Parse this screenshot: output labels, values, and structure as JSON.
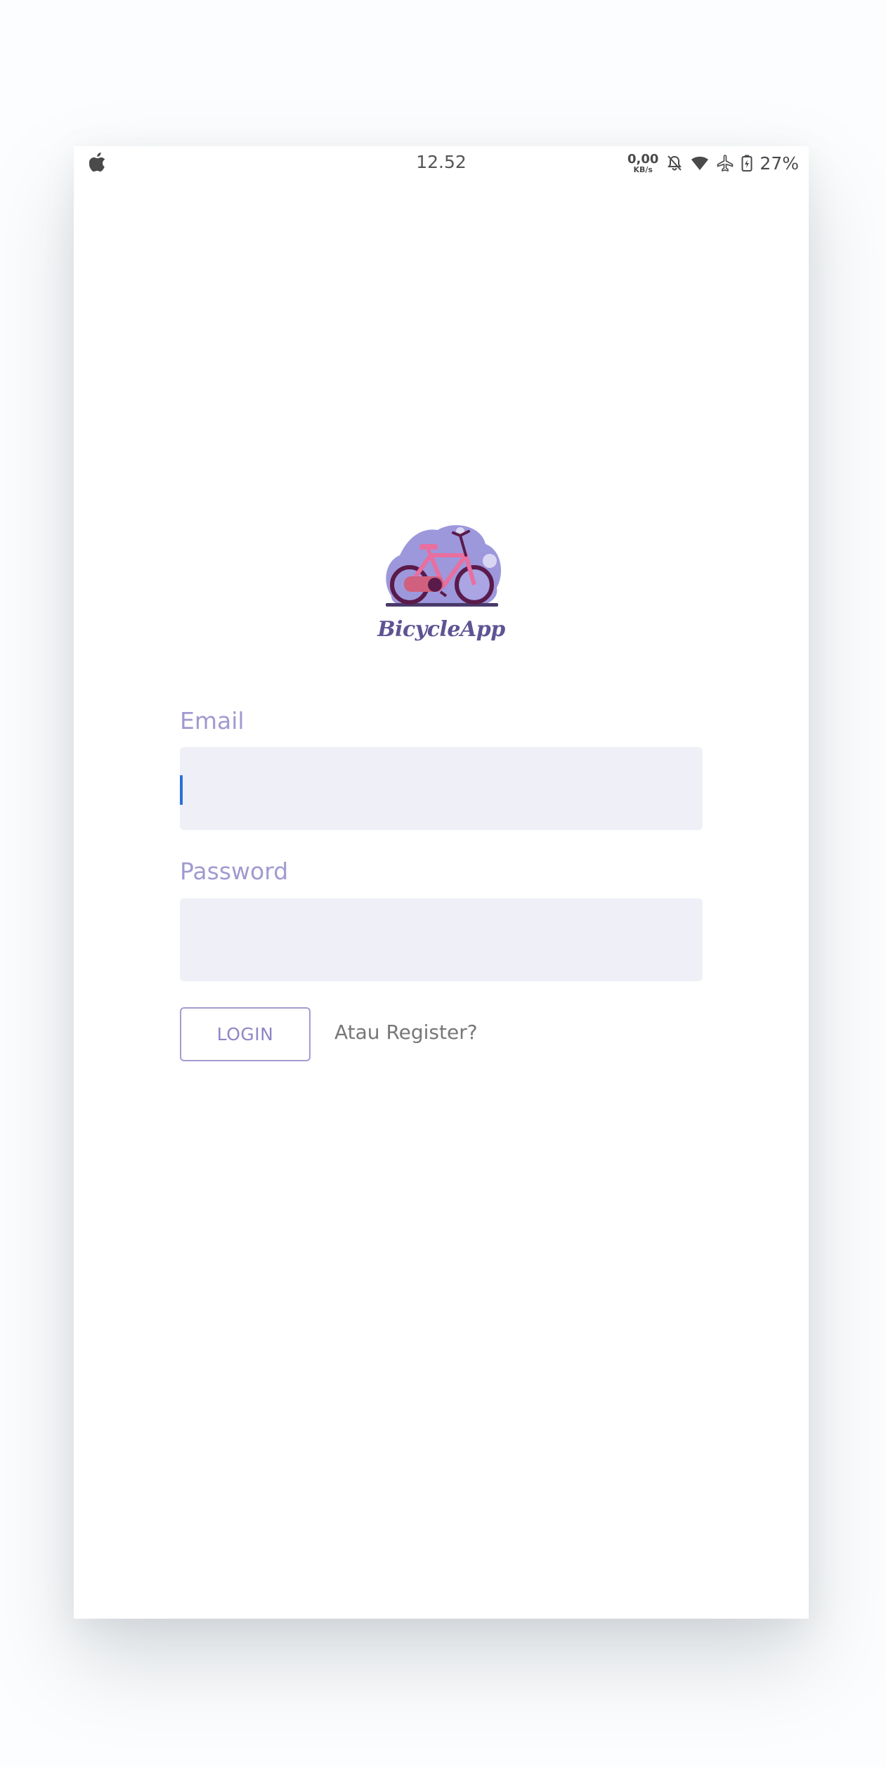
{
  "status_bar": {
    "time": "12.52",
    "net_speed_value": "0,00",
    "net_speed_unit": "KB/s",
    "battery_percent": "27%",
    "icons": [
      "apple-icon",
      "bell-off-icon",
      "wifi-icon",
      "airplane-icon",
      "battery-charging-icon"
    ]
  },
  "logo": {
    "text": "BicycleApp",
    "colors": {
      "blob": "#9d98dc",
      "frame": "#e86f9f",
      "wheels": "#5a1a4a",
      "text": "#5d5494"
    }
  },
  "form": {
    "email_label": "Email",
    "email_value": "",
    "password_label": "Password",
    "password_value": "",
    "login_label": "LOGIN",
    "register_label": "Atau Register?"
  },
  "colors": {
    "accent": "#a09ad0",
    "field_bg": "#efeff7",
    "caret": "#2a6fd6"
  }
}
